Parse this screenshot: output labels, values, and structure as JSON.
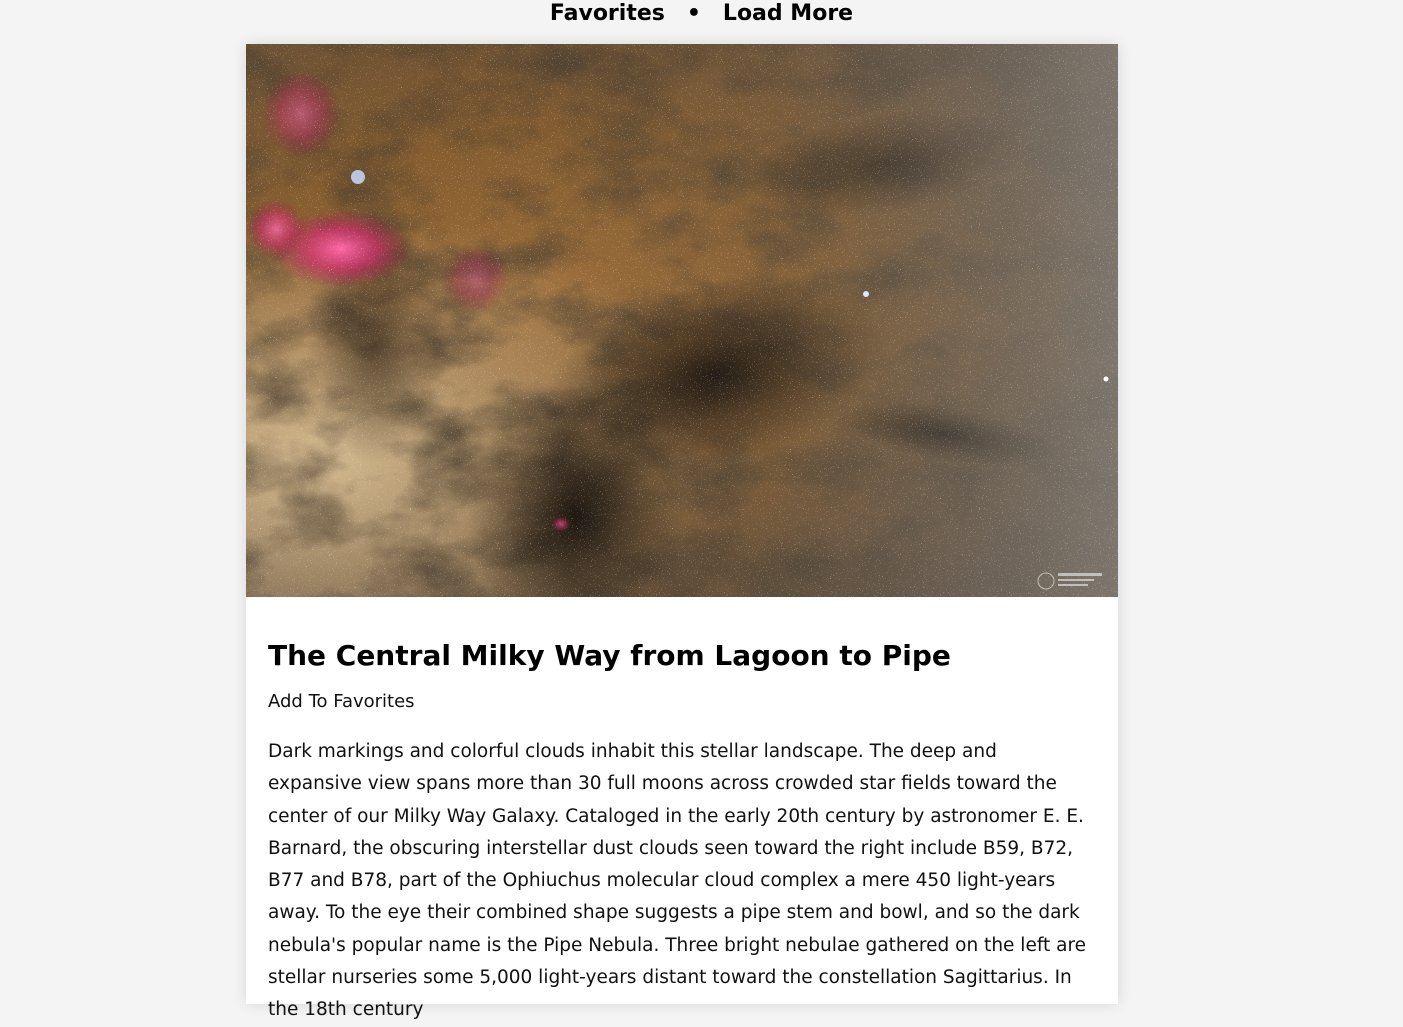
{
  "nav": {
    "favorites_label": "Favorites",
    "separator": "•",
    "load_more_label": "Load More"
  },
  "post": {
    "title": "The Central Milky Way from Lagoon to Pipe",
    "add_favorite_label": "Add To Favorites",
    "description": "Dark markings and colorful clouds inhabit this stellar landscape. The deep and expansive view spans more than 30 full moons across crowded star fields toward the center of our Milky Way Galaxy. Cataloged in the early 20th century by astronomer E. E. Barnard, the obscuring interstellar dust clouds seen toward the right include B59, B72, B77 and B78, part of the Ophiuchus molecular cloud complex a mere 450 light-years away. To the eye their combined shape suggests a pipe stem and bowl, and so the dark nebula's popular name is the Pipe Nebula. Three bright nebulae gathered on the left are stellar nurseries some 5,000 light-years distant toward the constellation Sagittarius. In the 18th century"
  },
  "colors": {
    "page_background": "#f4f4f4",
    "card_background": "#ffffff",
    "text": "#111111"
  }
}
